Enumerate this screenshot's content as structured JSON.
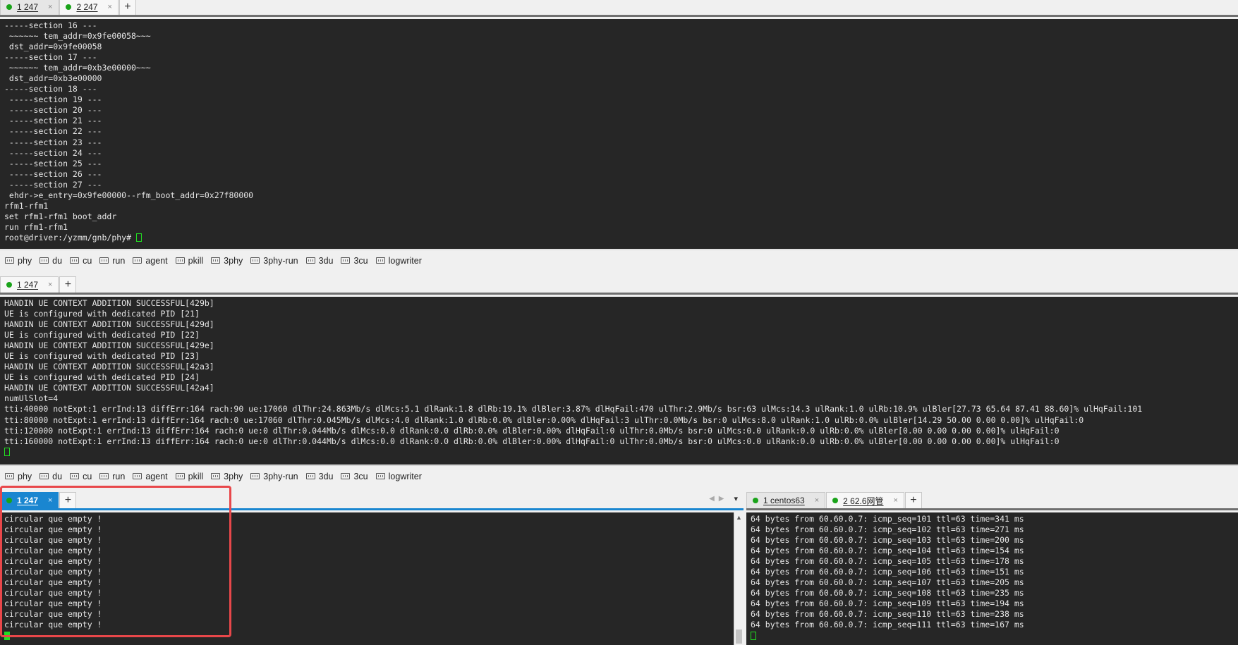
{
  "pane1": {
    "tabs": [
      {
        "label": "1 247",
        "close": "×"
      },
      {
        "label": "2 247",
        "close": "×"
      }
    ],
    "add_label": "+",
    "lines": [
      "-----section 16 ---",
      " ~~~~~~ tem_addr=0x9fe00058~~~",
      " dst_addr=0x9fe00058",
      "-----section 17 ---",
      " ~~~~~~ tem_addr=0xb3e00000~~~",
      " dst_addr=0xb3e00000",
      "-----section 18 ---",
      " -----section 19 ---",
      " -----section 20 ---",
      " -----section 21 ---",
      " -----section 22 ---",
      " -----section 23 ---",
      " -----section 24 ---",
      " -----section 25 ---",
      " -----section 26 ---",
      " -----section 27 ---",
      " ehdr->e_entry=0x9fe00000--rfm_boot_addr=0x27f80000",
      "rfm1-rfm1",
      "set rfm1-rfm1 boot_addr",
      "run rfm1-rfm1"
    ],
    "prompt": "root@driver:/yzmm/gnb/phy# "
  },
  "quick_commands": [
    "phy",
    "du",
    "cu",
    "run",
    "agent",
    "pkill",
    "3phy",
    "3phy-run",
    "3du",
    "3cu",
    "logwriter"
  ],
  "pane2": {
    "tabs": [
      {
        "label": "1 247",
        "close": "×"
      }
    ],
    "add_label": "+",
    "lines": [
      "HANDIN UE CONTEXT ADDITION SUCCESSFUL[429b]",
      "UE is configured with dedicated PID [21]",
      "HANDIN UE CONTEXT ADDITION SUCCESSFUL[429d]",
      "UE is configured with dedicated PID [22]",
      "HANDIN UE CONTEXT ADDITION SUCCESSFUL[429e]",
      "UE is configured with dedicated PID [23]",
      "HANDIN UE CONTEXT ADDITION SUCCESSFUL[42a3]",
      "UE is configured with dedicated PID [24]",
      "HANDIN UE CONTEXT ADDITION SUCCESSFUL[42a4]",
      "numUlSlot=4",
      "tti:40000 notExpt:1 errInd:13 diffErr:164 rach:90 ue:17060 dlThr:24.863Mb/s dlMcs:5.1 dlRank:1.8 dlRb:19.1% dlBler:3.87% dlHqFail:470 ulThr:2.9Mb/s bsr:63 ulMcs:14.3 ulRank:1.0 ulRb:10.9% ulBler[27.73 65.64 87.41 88.60]% ulHqFail:101",
      "tti:80000 notExpt:1 errInd:13 diffErr:164 rach:0 ue:17060 dlThr:0.045Mb/s dlMcs:4.0 dlRank:1.0 dlRb:0.0% dlBler:0.00% dlHqFail:3 ulThr:0.0Mb/s bsr:0 ulMcs:8.0 ulRank:1.0 ulRb:0.0% ulBler[14.29 50.00 0.00 0.00]% ulHqFail:0",
      "tti:120000 notExpt:1 errInd:13 diffErr:164 rach:0 ue:0 dlThr:0.044Mb/s dlMcs:0.0 dlRank:0.0 dlRb:0.0% dlBler:0.00% dlHqFail:0 ulThr:0.0Mb/s bsr:0 ulMcs:0.0 ulRank:0.0 ulRb:0.0% ulBler[0.00 0.00 0.00 0.00]% ulHqFail:0",
      "tti:160000 notExpt:1 errInd:13 diffErr:164 rach:0 ue:0 dlThr:0.044Mb/s dlMcs:0.0 dlRank:0.0 dlRb:0.0% dlBler:0.00% dlHqFail:0 ulThr:0.0Mb/s bsr:0 ulMcs:0.0 ulRank:0.0 ulRb:0.0% ulBler[0.00 0.00 0.00 0.00]% ulHqFail:0"
    ]
  },
  "pane3": {
    "tabs": [
      {
        "label": "1 247",
        "close": "×"
      }
    ],
    "add_label": "+",
    "lines": [
      "circular que empty !",
      "circular que empty !",
      "circular que empty !",
      "circular que empty !",
      "circular que empty !",
      "circular que empty !",
      "circular que empty !",
      "circular que empty !",
      "circular que empty !",
      "circular que empty !",
      "circular que empty !"
    ],
    "nav": {
      "prev": "◀",
      "next": "▶",
      "menu": "▾"
    }
  },
  "pane4": {
    "tabs": [
      {
        "label": "1 centos63",
        "close": "×"
      },
      {
        "label": "2 62.6网管",
        "close": "×"
      }
    ],
    "add_label": "+",
    "lines": [
      "64 bytes from 60.60.0.7: icmp_seq=101 ttl=63 time=341 ms",
      "64 bytes from 60.60.0.7: icmp_seq=102 ttl=63 time=271 ms",
      "64 bytes from 60.60.0.7: icmp_seq=103 ttl=63 time=200 ms",
      "64 bytes from 60.60.0.7: icmp_seq=104 ttl=63 time=154 ms",
      "64 bytes from 60.60.0.7: icmp_seq=105 ttl=63 time=178 ms",
      "64 bytes from 60.60.0.7: icmp_seq=106 ttl=63 time=151 ms",
      "64 bytes from 60.60.0.7: icmp_seq=107 ttl=63 time=205 ms",
      "64 bytes from 60.60.0.7: icmp_seq=108 ttl=63 time=235 ms",
      "64 bytes from 60.60.0.7: icmp_seq=109 ttl=63 time=194 ms",
      "64 bytes from 60.60.0.7: icmp_seq=110 ttl=63 time=238 ms",
      "64 bytes from 60.60.0.7: icmp_seq=111 ttl=63 time=167 ms"
    ]
  },
  "colors": {
    "terminal_bg": "#262626",
    "cursor": "#22dd22",
    "active_tab": "#1a86d0",
    "highlight": "#e8474a"
  }
}
